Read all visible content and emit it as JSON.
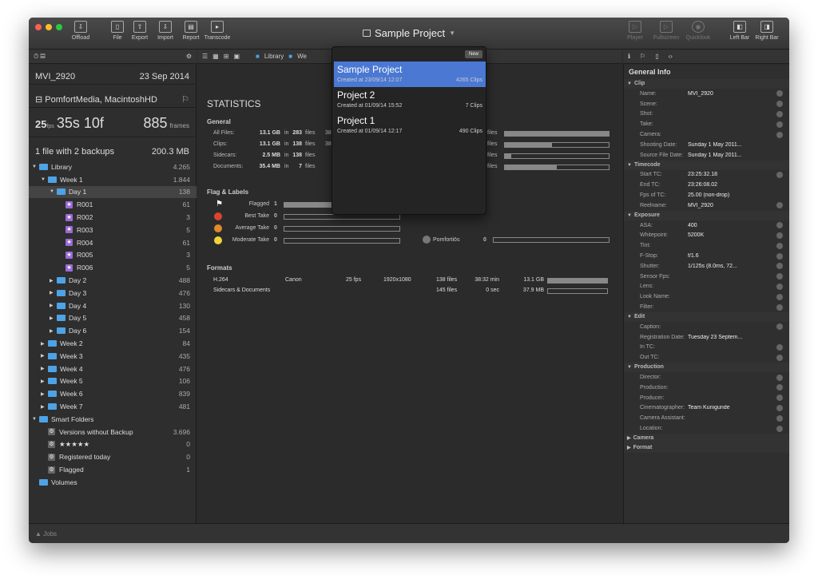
{
  "toolbar": {
    "offload": "Offload",
    "file": "File",
    "export": "Export",
    "import": "Import",
    "report": "Report",
    "transcode": "Transcode",
    "title": "Sample Project",
    "player": "Player",
    "fullscreen": "Fullscreen",
    "quicklook": "Quicklook",
    "left_bar": "Left Bar",
    "right_bar": "Right Bar"
  },
  "breadcrumb": {
    "library": "Library",
    "week": "We"
  },
  "clip": {
    "name": "MVI_2920",
    "date": "23 Sep 2014",
    "volume": "PomfortMedia, MacintoshHD",
    "fps": "25",
    "fps_unit": "fps",
    "duration": "35s 10f",
    "frames": "885",
    "frames_unit": "frames",
    "backups": "1 file with 2 backups",
    "size": "200.3 MB"
  },
  "tree": [
    {
      "label": "Library",
      "count": "4.265",
      "type": "lib",
      "indent": 0,
      "open": true
    },
    {
      "label": "Week 1",
      "count": "1.844",
      "type": "folder",
      "indent": 1,
      "open": true
    },
    {
      "label": "Day 1",
      "count": "138",
      "type": "folder",
      "indent": 2,
      "open": true,
      "sel": true
    },
    {
      "label": "R001",
      "count": "61",
      "type": "star",
      "indent": 3
    },
    {
      "label": "R002",
      "count": "3",
      "type": "star",
      "indent": 3
    },
    {
      "label": "R003",
      "count": "5",
      "type": "star",
      "indent": 3
    },
    {
      "label": "R004",
      "count": "61",
      "type": "star",
      "indent": 3
    },
    {
      "label": "R005",
      "count": "3",
      "type": "star",
      "indent": 3
    },
    {
      "label": "R006",
      "count": "5",
      "type": "star",
      "indent": 3
    },
    {
      "label": "Day 2",
      "count": "488",
      "type": "folder",
      "indent": 2
    },
    {
      "label": "Day 3",
      "count": "476",
      "type": "folder",
      "indent": 2
    },
    {
      "label": "Day 4",
      "count": "130",
      "type": "folder",
      "indent": 2
    },
    {
      "label": "Day 5",
      "count": "458",
      "type": "folder",
      "indent": 2
    },
    {
      "label": "Day 6",
      "count": "154",
      "type": "folder",
      "indent": 2
    },
    {
      "label": "Week 2",
      "count": "84",
      "type": "folder",
      "indent": 1
    },
    {
      "label": "Week 3",
      "count": "435",
      "type": "folder",
      "indent": 1
    },
    {
      "label": "Week 4",
      "count": "476",
      "type": "folder",
      "indent": 1
    },
    {
      "label": "Week 5",
      "count": "106",
      "type": "folder",
      "indent": 1
    },
    {
      "label": "Week 6",
      "count": "839",
      "type": "folder",
      "indent": 1
    },
    {
      "label": "Week 7",
      "count": "481",
      "type": "folder",
      "indent": 1
    },
    {
      "label": "Smart Folders",
      "count": "",
      "type": "lib",
      "indent": 0,
      "open": true
    },
    {
      "label": "Versions without Backup",
      "count": "3.696",
      "type": "gear",
      "indent": 1
    },
    {
      "label": "★★★★★",
      "count": "0",
      "type": "gear",
      "indent": 1
    },
    {
      "label": "Registered today",
      "count": "0",
      "type": "gear",
      "indent": 1
    },
    {
      "label": "Flagged",
      "count": "1",
      "type": "gear",
      "indent": 1
    },
    {
      "label": "Volumes",
      "count": "",
      "type": "lib",
      "indent": 0
    }
  ],
  "jobs": "Jobs",
  "stats": {
    "title": "STATISTICS",
    "general": "General",
    "rows": [
      {
        "k": "All Files:",
        "v": "13.1 GB",
        "in": "in",
        "n": "283",
        "u": "files",
        "x": "38",
        "fill": 1.0
      },
      {
        "k": "Clips:",
        "v": "13.1 GB",
        "in": "in",
        "n": "138",
        "u": "files",
        "x": "38",
        "fill": 0.45
      },
      {
        "k": "Sidecars:",
        "v": "2.5 MB",
        "in": "in",
        "n": "138",
        "u": "files",
        "x": "",
        "fill": 0.06
      },
      {
        "k": "Documents:",
        "v": "35.4 MB",
        "in": "in",
        "n": "7",
        "u": "files",
        "x": "",
        "fill": 0.5
      }
    ],
    "right_files": "files",
    "flags_title": "Flag & Labels",
    "flags": [
      {
        "label": "Flagged",
        "count": "1",
        "color": "#ffffff"
      },
      {
        "label": "Best Take",
        "count": "0",
        "color": "#d9452c"
      },
      {
        "label": "Average Take",
        "count": "0",
        "color": "#e08a2a"
      },
      {
        "label": "Moderate Take",
        "count": "0",
        "color": "#f2d23a"
      }
    ],
    "pomfort": {
      "label": "Pomfortiōs",
      "count": "0"
    },
    "formats_title": "Formats",
    "formats": [
      {
        "codec": "H.264",
        "brand": "Canon",
        "fps": "25 fps",
        "res": "1920x1080",
        "files": "138 files",
        "dur": "38:32 min",
        "size": "13.1 GB",
        "fill": 1.0
      },
      {
        "codec": "Sidecars & Documents",
        "brand": "",
        "fps": "",
        "res": "",
        "files": "145 files",
        "dur": "0 sec",
        "size": "37.9 MB",
        "fill": 0.0
      }
    ]
  },
  "popup": {
    "new": "New",
    "projects": [
      {
        "name": "Sample Project",
        "created": "Created at 23/09/14 12:07",
        "clips": "4265 Clips",
        "sel": true
      },
      {
        "name": "Project 2",
        "created": "Created at 01/09/14 15:52",
        "clips": "7 Clips"
      },
      {
        "name": "Project 1",
        "created": "Created at 01/09/14 12:17",
        "clips": "490 Clips"
      }
    ]
  },
  "inspector": {
    "title": "General Info",
    "groups": [
      {
        "name": "Clip",
        "rows": [
          [
            "Name:",
            "MVI_2920",
            1
          ],
          [
            "Scene:",
            "",
            1
          ],
          [
            "Shot:",
            "",
            1
          ],
          [
            "Take:",
            "",
            1
          ],
          [
            "Camera:",
            "",
            1
          ],
          [
            "Shooting Date:",
            "Sunday 1 May 2011...",
            0
          ],
          [
            "Source File Date:",
            "Sunday 1 May 2011...",
            0
          ]
        ]
      },
      {
        "name": "Timecode",
        "rows": [
          [
            "Start TC:",
            "23:25:32.18",
            1
          ],
          [
            "End TC:",
            "23:26:08.02",
            0
          ],
          [
            "Fps of TC:",
            "25.00 (non-drop)",
            0
          ],
          [
            "Reelname:",
            "MVI_2920",
            1
          ]
        ]
      },
      {
        "name": "Exposure",
        "rows": [
          [
            "ASA:",
            "400",
            1
          ],
          [
            "Whitepoint:",
            "5200K",
            1
          ],
          [
            "Tint:",
            "",
            1
          ],
          [
            "F-Stop:",
            "f/1.6",
            1
          ],
          [
            "Shutter:",
            "1/125s (8.0ms, 72...",
            1
          ],
          [
            "Sensor Fps:",
            "",
            1
          ],
          [
            "Lens:",
            "",
            1
          ],
          [
            "Look Name:",
            "",
            1
          ],
          [
            "Filter:",
            "",
            1
          ]
        ]
      },
      {
        "name": "Edit",
        "rows": [
          [
            "Caption:",
            "",
            1
          ],
          [
            "Registration Date:",
            "Tuesday 23 Septem...",
            0
          ],
          [
            "In TC:",
            "",
            1
          ],
          [
            "Out TC:",
            "",
            1
          ]
        ]
      },
      {
        "name": "Production",
        "rows": [
          [
            "Director:",
            "",
            1
          ],
          [
            "Production:",
            "",
            1
          ],
          [
            "Producer:",
            "",
            1
          ],
          [
            "Cinematographer:",
            "Team Kunigunde",
            1
          ],
          [
            "Camera Assistant:",
            "",
            1
          ],
          [
            "Location:",
            "",
            1
          ]
        ]
      }
    ],
    "collapsed": [
      "Camera",
      "Format"
    ]
  }
}
